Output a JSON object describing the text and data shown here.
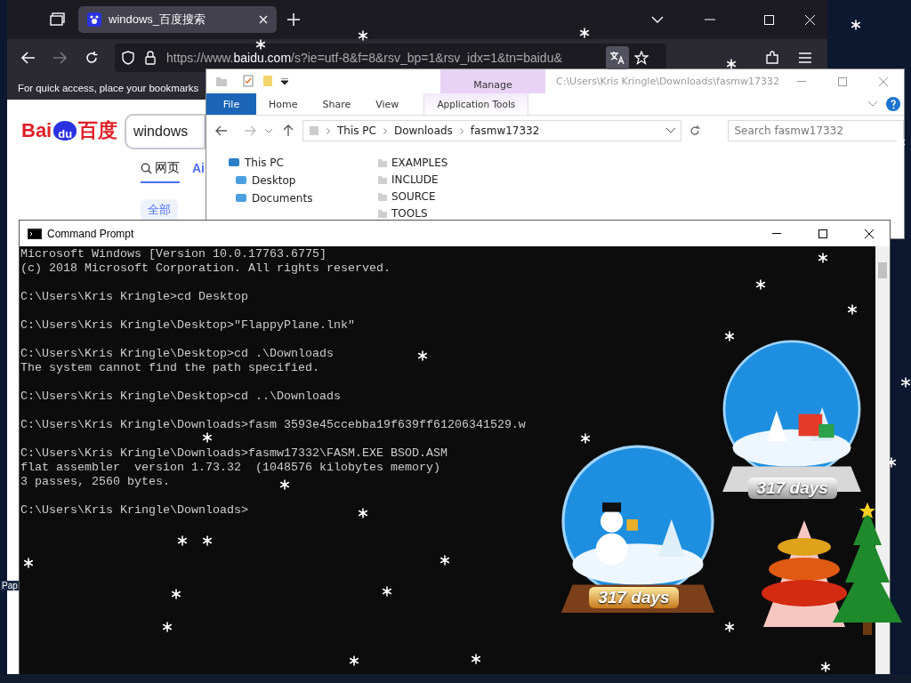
{
  "browser": {
    "tab": {
      "title": "windows_百度搜索",
      "selected": true
    },
    "url": {
      "prefix": "https://www.",
      "domain": "baidu.com",
      "rest": "/s?ie=utf-8&f=8&rsv_bp=1&rsv_idx=1&tn=baidu&"
    },
    "translate_active": true,
    "bookmarks_hint": "For quick access, place your bookmarks",
    "page": {
      "logo": {
        "left": "Bai",
        "paw": "du",
        "right": "百度"
      },
      "search_value": "windows",
      "tabs": [
        {
          "label": "网页",
          "selected": true
        },
        {
          "label": "Ai",
          "selected": false
        }
      ],
      "filter": "全部"
    }
  },
  "explorer": {
    "context_group": "Manage",
    "title": "C:\\Users\\Kris Kringle\\Downloads\\fasmw17332",
    "ribbon_tabs": [
      {
        "label": "File",
        "kind": "file"
      },
      {
        "label": "Home",
        "kind": "tab"
      },
      {
        "label": "Share",
        "kind": "tab"
      },
      {
        "label": "View",
        "kind": "tab"
      },
      {
        "label": "Application Tools",
        "kind": "context"
      }
    ],
    "breadcrumbs": [
      "This PC",
      "Downloads",
      "fasmw17332"
    ],
    "search": {
      "placeholder": "Search fasmw17332"
    },
    "nav": [
      {
        "label": "This PC",
        "children": [
          {
            "label": "Desktop"
          },
          {
            "label": "Documents"
          }
        ]
      }
    ],
    "files": [
      "EXAMPLES",
      "INCLUDE",
      "SOURCE",
      "TOOLS"
    ]
  },
  "desktop_label": "Pap",
  "cmd": {
    "title": "Command Prompt",
    "blocks": [
      [
        "Microsoft Windows [Version 10.0.17763.6775]",
        "(c) 2018 Microsoft Corporation. All rights reserved."
      ],
      [
        "C:\\Users\\Kris Kringle>cd Desktop"
      ],
      [
        "C:\\Users\\Kris Kringle\\Desktop>\"FlappyPlane.lnk\""
      ],
      [
        "C:\\Users\\Kris Kringle\\Desktop>cd .\\Downloads",
        "The system cannot find the path specified."
      ],
      [
        "C:\\Users\\Kris Kringle\\Desktop>cd ..\\Downloads"
      ],
      [
        "C:\\Users\\Kris Kringle\\Downloads>fasm 3593e45ccebba19f639ff61206341529.w"
      ],
      [
        "C:\\Users\\Kris Kringle\\Downloads>fasmw17332\\FASM.EXE BSOD.ASM",
        "flat assembler  version 1.73.32  (1048576 kilobytes memory)",
        "3 passes, 2560 bytes."
      ],
      [
        "C:\\Users\\Kris Kringle\\Downloads>"
      ]
    ]
  },
  "globes": [
    {
      "days": "317 days"
    },
    {
      "days": "317 days"
    }
  ]
}
